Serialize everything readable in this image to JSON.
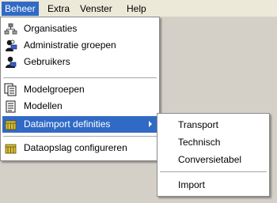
{
  "menubar": {
    "items": [
      {
        "label": "Beheer"
      },
      {
        "label": "Extra"
      },
      {
        "label": "Venster"
      },
      {
        "label": "Help"
      }
    ]
  },
  "beheer_menu": {
    "items": [
      {
        "label": "Organisaties",
        "icon": "organization-icon"
      },
      {
        "label": "Administratie groepen",
        "icon": "admin-groups-icon"
      },
      {
        "label": "Gebruikers",
        "icon": "users-icon"
      },
      {
        "label": "Modelgroepen",
        "icon": "model-groups-icon"
      },
      {
        "label": "Modellen",
        "icon": "models-icon"
      },
      {
        "label": "Dataimport definities",
        "icon": "data-import-icon"
      },
      {
        "label": "Dataopslag configureren",
        "icon": "data-storage-icon"
      }
    ]
  },
  "dataimport_submenu": {
    "items": [
      {
        "label": "Transport"
      },
      {
        "label": "Technisch"
      },
      {
        "label": "Conversietabel"
      },
      {
        "label": "Import"
      }
    ]
  },
  "colors": {
    "highlight": "#316ac5",
    "menubar": "#ece9d8",
    "background": "#d4d0c8"
  }
}
